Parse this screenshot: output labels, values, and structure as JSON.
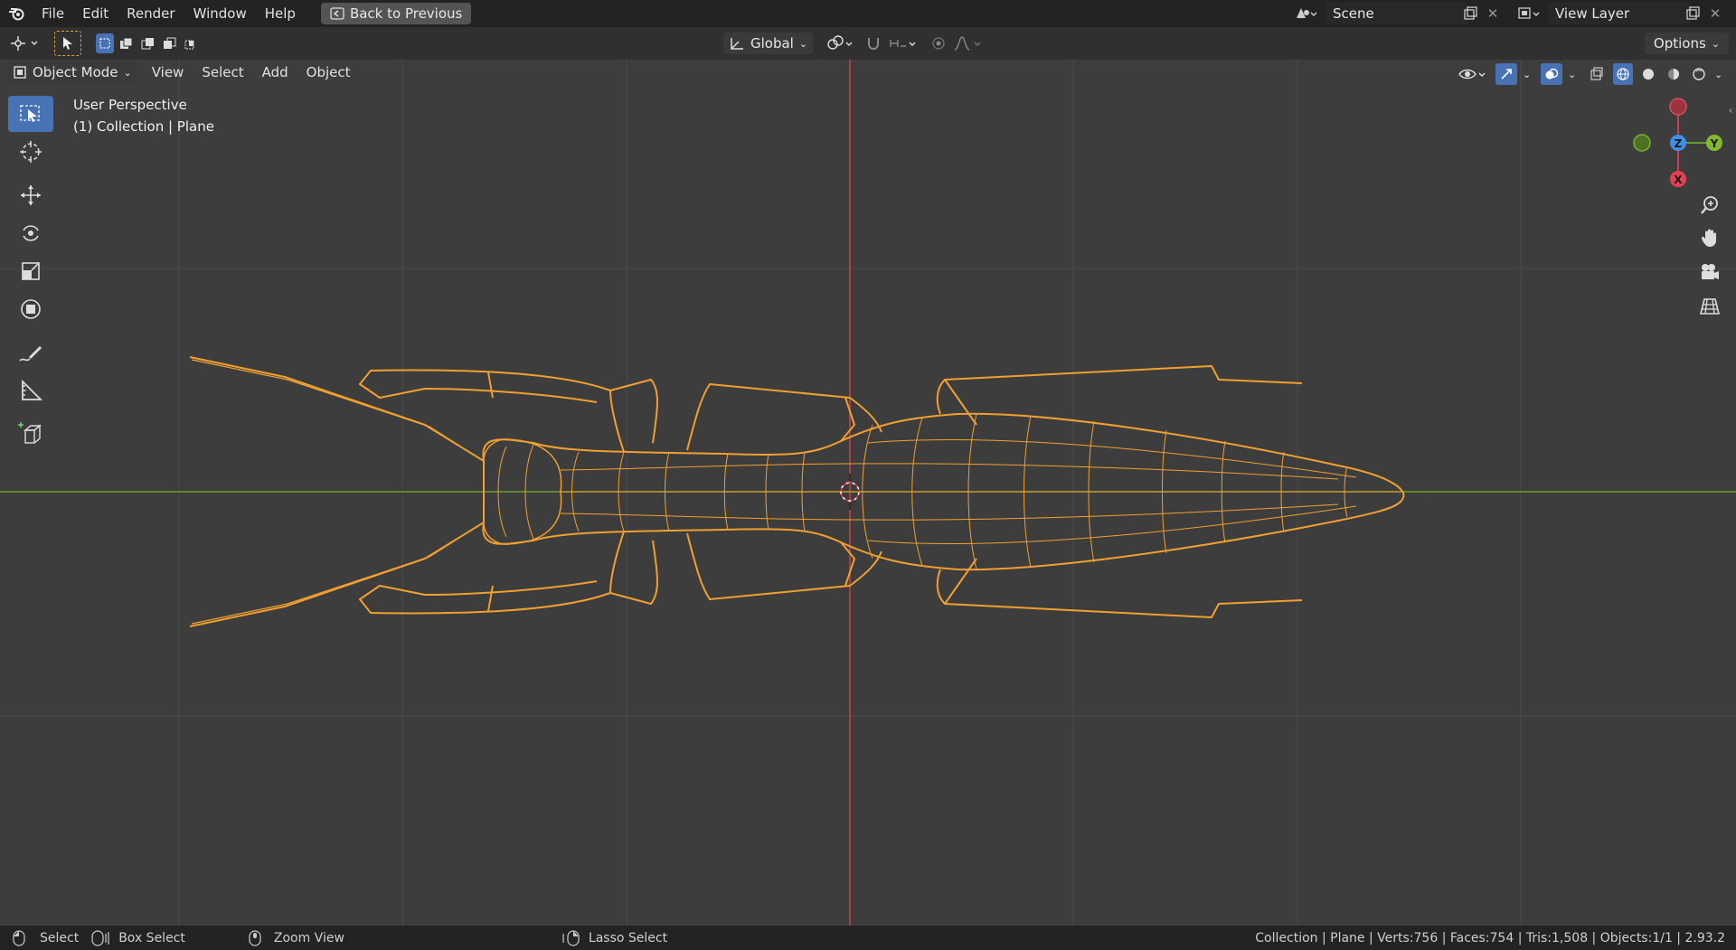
{
  "menu": {
    "items": [
      "File",
      "Edit",
      "Render",
      "Window",
      "Help"
    ],
    "back_button": "Back to Previous"
  },
  "scene": {
    "name": "Scene",
    "view_layer": "View Layer"
  },
  "header_tools": {
    "transform_orientation": "Global",
    "options": "Options"
  },
  "viewport_header": {
    "mode": "Object Mode",
    "menus": [
      "View",
      "Select",
      "Add",
      "Object"
    ]
  },
  "overlay": {
    "perspective": "User Perspective",
    "collection": "(1) Collection | Plane"
  },
  "gizmo": {
    "x": "X",
    "y": "Y",
    "z": "Z"
  },
  "status": {
    "select": "Select",
    "box_select": "Box Select",
    "zoom_view": "Zoom View",
    "lasso_select": "Lasso Select",
    "info": "Collection | Plane | Verts:756 | Faces:754 | Tris:1,508 | Objects:1/1 | 2.93.2"
  },
  "colors": {
    "wire": "#f0a030",
    "axis_x": "#c8404d",
    "axis_y": "#6a9e2a",
    "accent": "#4772b3"
  }
}
